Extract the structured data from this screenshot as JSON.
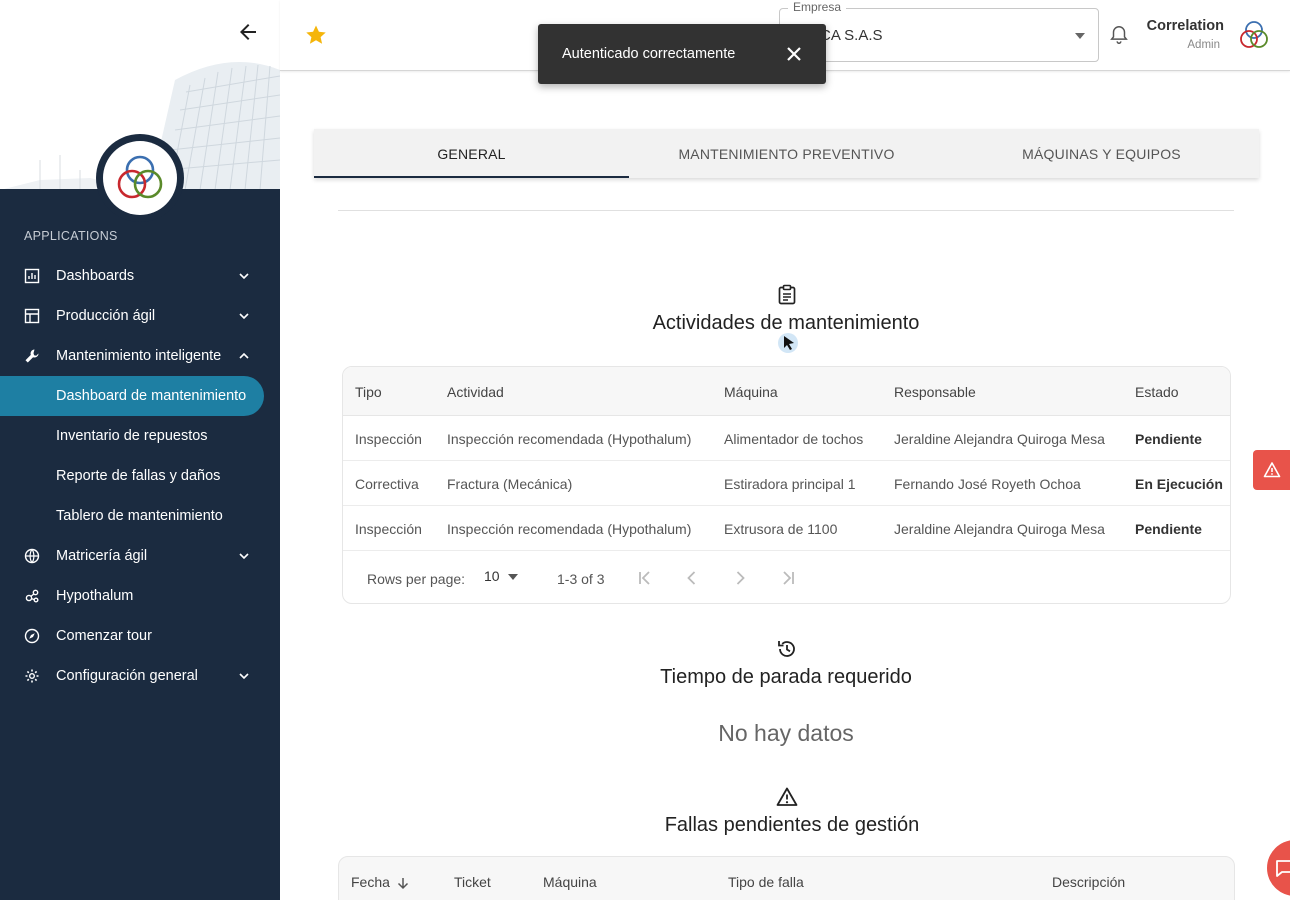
{
  "sidebar": {
    "section_label": "APPLICATIONS",
    "items": [
      {
        "label": "Dashboards",
        "icon": "bar-chart-icon"
      },
      {
        "label": "Producción ágil",
        "icon": "table-icon"
      },
      {
        "label": "Mantenimiento inteligente",
        "icon": "wrench-icon"
      },
      {
        "label": "Dashboard de mantenimiento"
      },
      {
        "label": "Inventario de repuestos"
      },
      {
        "label": "Reporte de fallas y daños"
      },
      {
        "label": "Tablero de mantenimiento"
      },
      {
        "label": "Matricería ágil",
        "icon": "globe-icon"
      },
      {
        "label": "Hypothalum",
        "icon": "molecule-icon"
      },
      {
        "label": "Comenzar tour",
        "icon": "compass-icon"
      },
      {
        "label": "Configuración general",
        "icon": "gear-icon"
      }
    ]
  },
  "header": {
    "empresa_label": "Empresa",
    "empresa_value": "CA S.A.S",
    "user_name": "Correlation",
    "user_role": "Admin"
  },
  "toast": {
    "message": "Autenticado correctamente"
  },
  "tabs": [
    {
      "label": "GENERAL",
      "active": true
    },
    {
      "label": "MANTENIMIENTO PREVENTIVO",
      "active": false
    },
    {
      "label": "MÁQUINAS Y EQUIPOS",
      "active": false
    }
  ],
  "activities": {
    "title": "Actividades de mantenimiento",
    "columns": [
      "Tipo",
      "Actividad",
      "Máquina",
      "Responsable",
      "Estado"
    ],
    "rows": [
      [
        "Inspección",
        "Inspección recomendada (Hypothalum)",
        "Alimentador de tochos",
        "Jeraldine Alejandra Quiroga Mesa",
        "Pendiente"
      ],
      [
        "Correctiva",
        "Fractura (Mecánica)",
        "Estiradora principal 1",
        "Fernando José Royeth Ochoa",
        "En Ejecución"
      ],
      [
        "Inspección",
        "Inspección recomendada (Hypothalum)",
        "Extrusora de 1100",
        "Jeraldine Alejandra Quiroga Mesa",
        "Pendiente"
      ]
    ],
    "pager": {
      "rows_label": "Rows per page:",
      "rows_value": "10",
      "range": "1-3 of 3"
    }
  },
  "downtime": {
    "title": "Tiempo de parada requerido",
    "empty": "No hay datos"
  },
  "failures": {
    "title": "Fallas pendientes de gestión",
    "columns": [
      "Fecha",
      "Ticket",
      "Máquina",
      "Tipo de falla",
      "Descripción"
    ]
  },
  "colors": {
    "sidebar_bg": "#1b2b40",
    "active_item": "#1e7fa3",
    "accent_red": "#e8534a",
    "star": "#f5b50a"
  }
}
